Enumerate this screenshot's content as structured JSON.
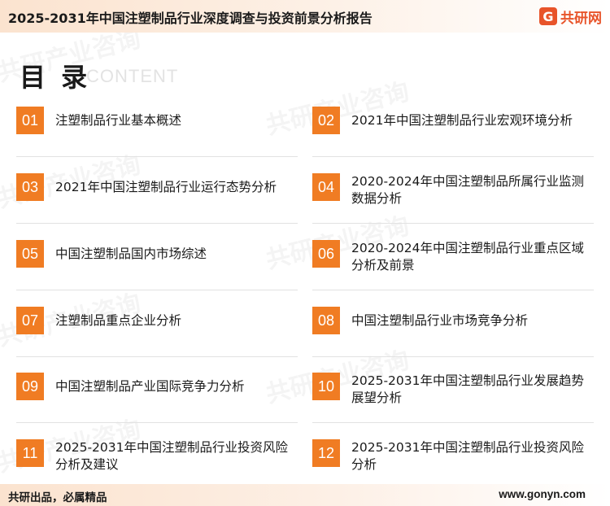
{
  "header": {
    "title": "2025-2031年中国注塑制品行业深度调查与投资前景分析报告",
    "logo_mark": "G",
    "logo_text": "共研网"
  },
  "toc": {
    "title": "目 录",
    "subtitle": "CONTENT",
    "items": [
      {
        "num": "01",
        "label": "注塑制品行业基本概述"
      },
      {
        "num": "02",
        "label": "2021年中国注塑制品行业宏观环境分析"
      },
      {
        "num": "03",
        "label": "2021年中国注塑制品行业运行态势分析"
      },
      {
        "num": "04",
        "label": "2020-2024年中国注塑制品所属行业监测数据分析"
      },
      {
        "num": "05",
        "label": "中国注塑制品国内市场综述"
      },
      {
        "num": "06",
        "label": "2020-2024年中国注塑制品行业重点区域分析及前景"
      },
      {
        "num": "07",
        "label": "注塑制品重点企业分析"
      },
      {
        "num": "08",
        "label": "中国注塑制品行业市场竞争分析"
      },
      {
        "num": "09",
        "label": "中国注塑制品产业国际竞争力分析"
      },
      {
        "num": "10",
        "label": "2025-2031年中国注塑制品行业发展趋势展望分析"
      },
      {
        "num": "11",
        "label": "2025-2031年中国注塑制品行业投资风险分析及建议"
      },
      {
        "num": "12",
        "label": "2025-2031年中国注塑制品行业投资风险分析"
      }
    ]
  },
  "watermark": {
    "text": "共研产业咨询",
    "url": "www.gonyn.com"
  },
  "footer": {
    "left": "共研出品，必属精品",
    "right": "www.gonyn.com"
  },
  "colors": {
    "accent": "#f07c23",
    "brand": "#e8542a"
  }
}
